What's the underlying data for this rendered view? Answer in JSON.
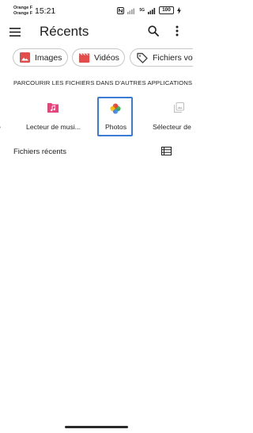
{
  "status_bar": {
    "carrier_line1": "Orange F",
    "carrier_line2": "Orange F",
    "time": "15:21",
    "network": "5G",
    "battery": "100"
  },
  "appbar": {
    "title": "Récents",
    "icons": [
      "menu-icon",
      "search-icon",
      "more-vert-icon"
    ]
  },
  "chips": [
    {
      "label": "Images",
      "icon": "image-icon",
      "color": "#e24c4b"
    },
    {
      "label": "Vidéos",
      "icon": "movie-icon",
      "color": "#e24c4b"
    },
    {
      "label": "Fichiers volu",
      "icon": "tag-icon",
      "color": "#444444"
    }
  ],
  "section": {
    "title": "PARCOURIR LES FICHIERS DANS D'AUTRES APPLICATIONS"
  },
  "apps": {
    "partial_left_label": "e",
    "items": [
      {
        "label": "Lecteur de musi...",
        "icon": "music-player-icon",
        "color": "#e8447c"
      },
      {
        "label": "Photos",
        "icon": "photos-pinwheel-icon",
        "selected": true,
        "selection_color": "#3a7bd5"
      },
      {
        "label": "Sélecteur de",
        "icon": "file-selector-icon",
        "color": "#bdbdbd"
      }
    ]
  },
  "recent": {
    "title": "Fichiers récents",
    "view_icon": "list-view-icon"
  }
}
